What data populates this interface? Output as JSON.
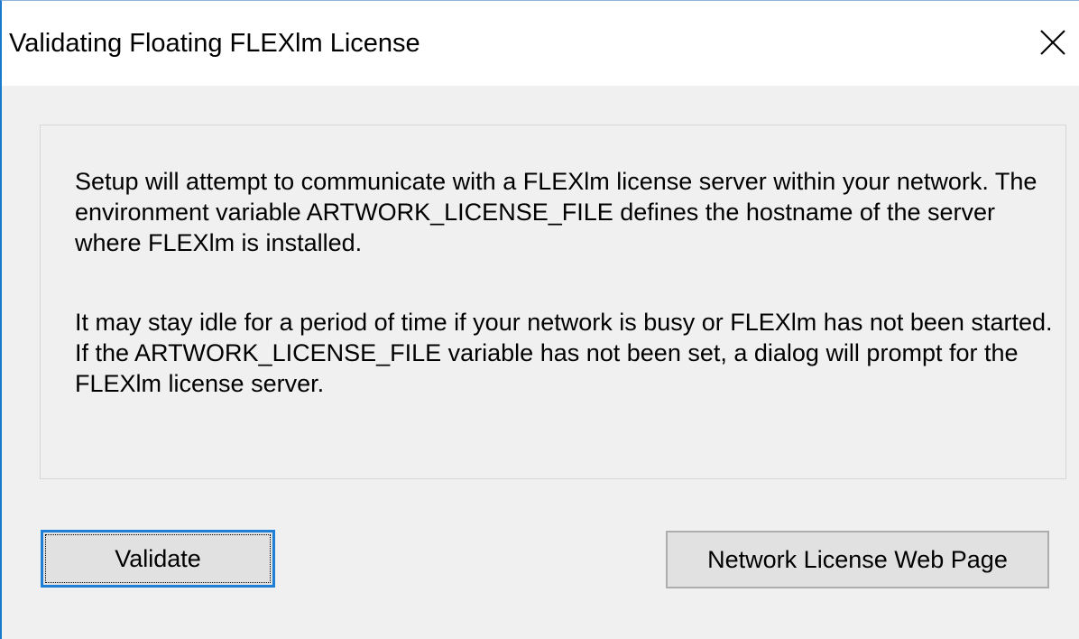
{
  "dialog": {
    "title": "Validating Floating FLEXlm License",
    "close_icon": "close-icon"
  },
  "message": {
    "paragraph1": "Setup will attempt to communicate with a FLEXlm license server within your network.  The environment variable ARTWORK_LICENSE_FILE defines the hostname of the server where FLEXlm is installed.",
    "paragraph2": "It may stay idle for a period of time if your network is busy or FLEXlm has not been started.  If the ARTWORK_LICENSE_FILE variable has not been set, a dialog will prompt for the FLEXlm license server."
  },
  "buttons": {
    "validate_label": "Validate",
    "network_label": "Network License Web Page"
  },
  "colors": {
    "focus_border": "#1f7fd6",
    "window_border": "#1979ca",
    "dialog_bg": "#f0f0f0",
    "titlebar_bg": "#ffffff"
  }
}
